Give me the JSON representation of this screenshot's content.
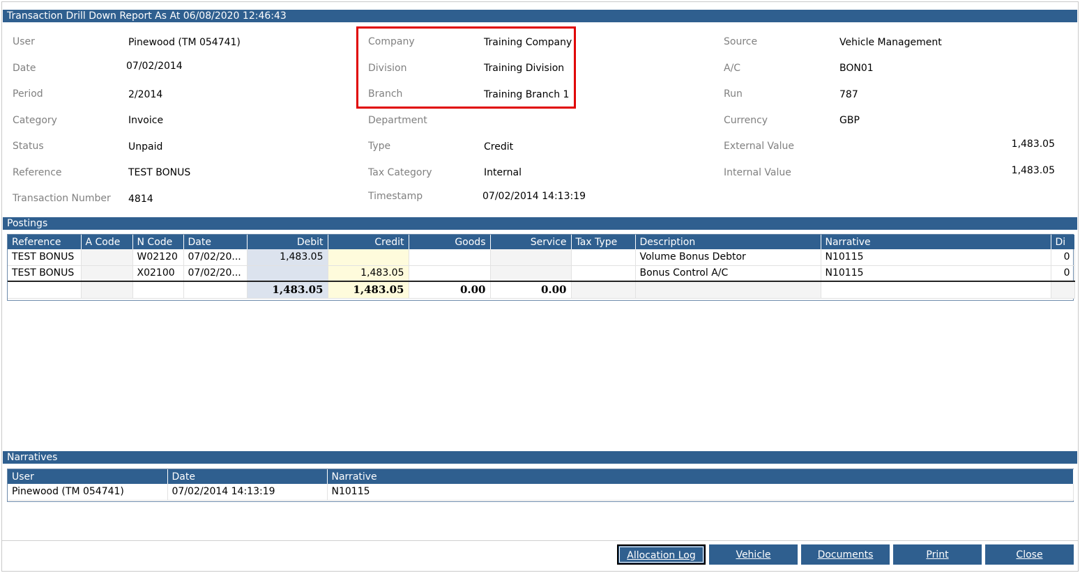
{
  "window": {
    "title": "Transaction Drill Down Report As At 06/08/2020 12:46:43"
  },
  "details": {
    "col1": [
      {
        "label": "User",
        "value": "Pinewood (TM 054741)"
      },
      {
        "label": "Date",
        "value": "07/02/2014"
      },
      {
        "label": "Period",
        "value": "2/2014"
      },
      {
        "label": "Category",
        "value": "Invoice"
      },
      {
        "label": "Status",
        "value": "Unpaid"
      },
      {
        "label": "Reference",
        "value": "TEST BONUS"
      },
      {
        "label": "Transaction Number",
        "value": "4814"
      }
    ],
    "col2": [
      {
        "label": "Company",
        "value": "Training Company"
      },
      {
        "label": "Division",
        "value": "Training Division"
      },
      {
        "label": "Branch",
        "value": "Training Branch 1"
      },
      {
        "label": "Department",
        "value": ""
      },
      {
        "label": "Type",
        "value": "Credit"
      },
      {
        "label": "Tax Category",
        "value": "Internal"
      },
      {
        "label": "Timestamp",
        "value": "07/02/2014 14:13:19"
      }
    ],
    "col3": [
      {
        "label": "Source",
        "value": "Vehicle Management"
      },
      {
        "label": "A/C",
        "value": "BON01"
      },
      {
        "label": "Run",
        "value": "787"
      },
      {
        "label": "Currency",
        "value": "GBP"
      },
      {
        "label": "External Value",
        "value": "1,483.05"
      },
      {
        "label": "Internal Value",
        "value": "1,483.05"
      }
    ],
    "highlight_color": "#e00000"
  },
  "postings": {
    "section_title": "Postings",
    "columns": [
      "Reference",
      "A Code",
      "N Code",
      "Date",
      "Debit",
      "Credit",
      "Goods",
      "Service",
      "Tax Type",
      "Description",
      "Narrative",
      "Di"
    ],
    "rows": [
      [
        "TEST BONUS",
        "",
        "W02120",
        "07/02/20...",
        "1,483.05",
        "",
        "",
        "",
        "",
        "Volume Bonus Debtor",
        "N10115",
        "0"
      ],
      [
        "TEST BONUS",
        "",
        "X02100",
        "07/02/20...",
        "",
        "1,483.05",
        "",
        "",
        "",
        "Bonus Control A/C",
        "N10115",
        "0"
      ]
    ],
    "totals": [
      "",
      "",
      "",
      "",
      "1,483.05",
      "1,483.05",
      "0.00",
      "0.00",
      "",
      "",
      "",
      ""
    ]
  },
  "narratives": {
    "section_title": "Narratives",
    "columns": [
      "User",
      "Date",
      "Narrative"
    ],
    "rows": [
      [
        "Pinewood (TM 054741)",
        "07/02/2014 14:13:19",
        "N10115"
      ]
    ]
  },
  "buttons": {
    "allocation_log": "Allocation Log",
    "vehicle": "Vehicle",
    "documents": "Documents",
    "print": "Print",
    "close": "Close"
  },
  "colors": {
    "header_blue": "#2f5f8f",
    "debit_bg": "#dce3ee",
    "credit_bg": "#fefbdc"
  }
}
